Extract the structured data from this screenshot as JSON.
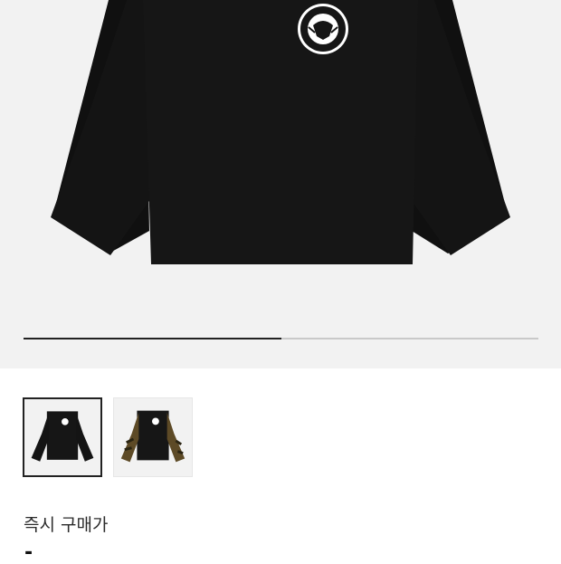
{
  "product": {
    "main_image": "black-long-sleeve-tee-with-eagle-seal-logo",
    "gallery_position": 0.5
  },
  "thumbnails": [
    {
      "image": "black-long-sleeve-tee",
      "selected": true
    },
    {
      "image": "black-tee-with-camo-sleeves",
      "selected": false
    }
  ],
  "price": {
    "label": "즉시 구매가",
    "value": "-"
  },
  "colors": {
    "shirt": "#141414",
    "background": "#f2f2f2",
    "camo": "#5d4a26"
  }
}
